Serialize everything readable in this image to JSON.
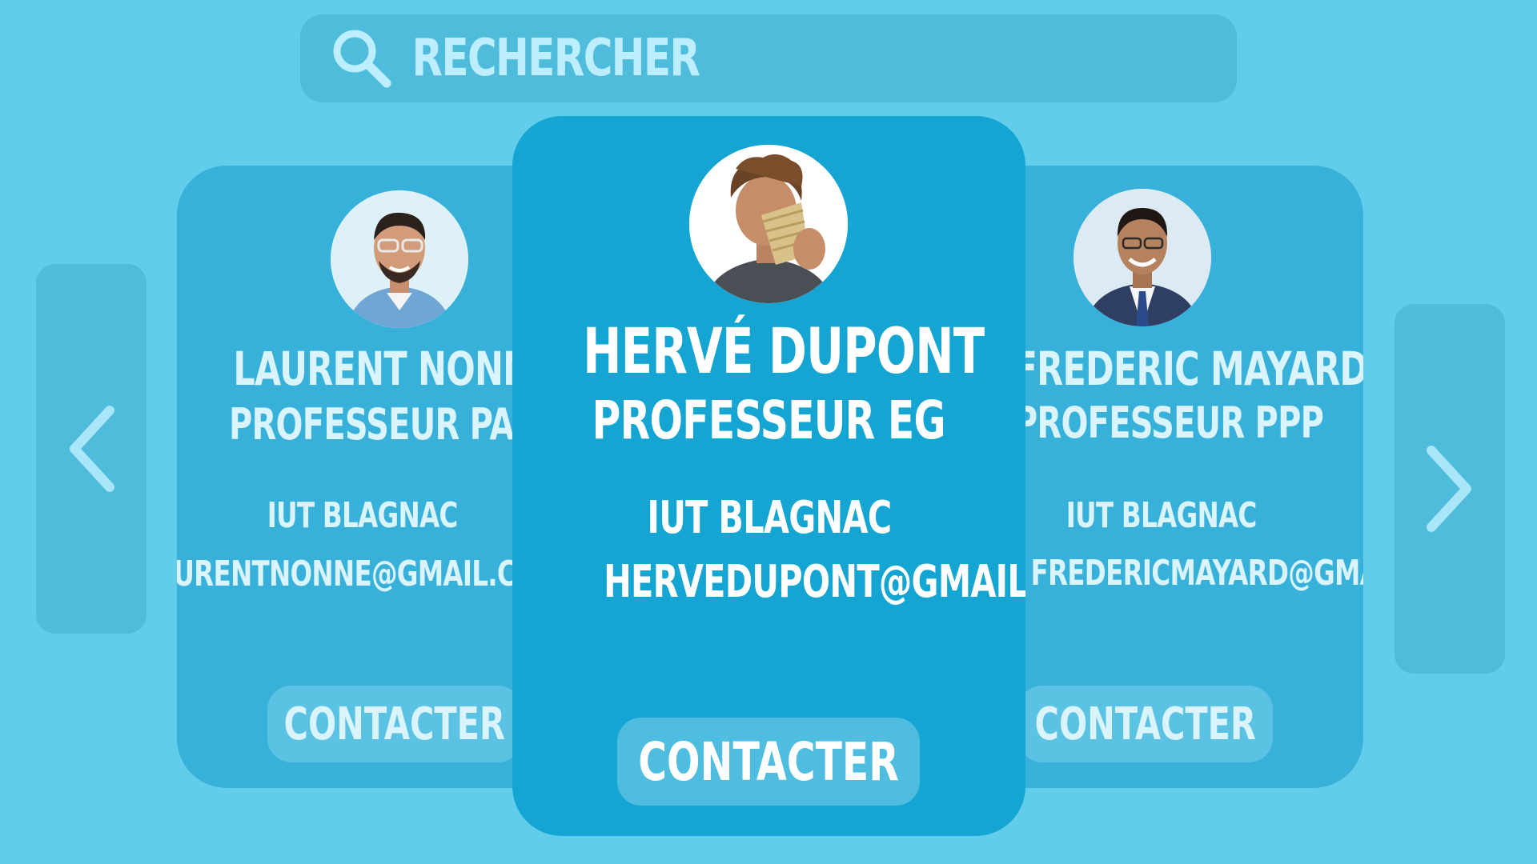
{
  "search": {
    "placeholder": "RECHERCHER",
    "icon": "search-icon"
  },
  "navigation": {
    "prev_icon": "chevron-left-icon",
    "next_icon": "chevron-right-icon"
  },
  "cards": {
    "left": {
      "name": "LAURENT NONNE",
      "role": "PROFESSEUR PAI",
      "school": "IUT BLAGNAC",
      "email": "LAURENTNONNE@GMAIL.COM",
      "contact_label": "CONTACTER"
    },
    "center": {
      "name": "HERVÉ DUPONT",
      "role": "PROFESSEUR EG",
      "school": "IUT BLAGNAC",
      "email": "HERVEDUPONT@GMAIL.COM",
      "contact_label": "CONTACTER"
    },
    "right": {
      "name": "FREDERIC MAYARD",
      "role": "PROFESSEUR PPP",
      "school": "IUT BLAGNAC",
      "email": "FREDERICMAYARD@GMAIL.COM",
      "contact_label": "CONTACTER"
    }
  },
  "colors": {
    "background": "#62cdeb",
    "card_center": "#14a5d3",
    "card_side": "#37b0da",
    "panel": "#4fbcdc",
    "text_light": "#d9f4fd"
  }
}
